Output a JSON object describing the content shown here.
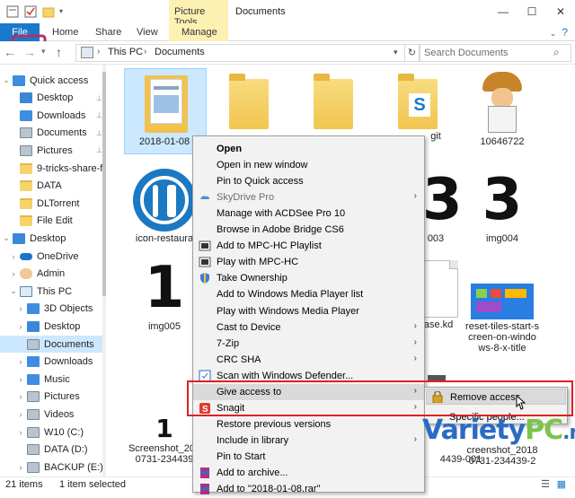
{
  "window": {
    "context_tab_group": "Picture Tools",
    "title": "Documents"
  },
  "ribbon": {
    "tabs": [
      "File",
      "Home",
      "Share",
      "View",
      "Manage"
    ],
    "help": "?"
  },
  "address": {
    "segments": [
      "This PC",
      "Documents"
    ],
    "search_placeholder": "Search Documents"
  },
  "navpane": {
    "items": [
      {
        "label": "Quick access",
        "icon": "star-icon",
        "level": 0
      },
      {
        "label": "Desktop",
        "icon": "desktop-icon",
        "level": 1,
        "pinned": true
      },
      {
        "label": "Downloads",
        "icon": "downloads-icon",
        "level": 1,
        "pinned": true
      },
      {
        "label": "Documents",
        "icon": "documents-icon",
        "level": 1,
        "pinned": true
      },
      {
        "label": "Pictures",
        "icon": "pictures-icon",
        "level": 1,
        "pinned": true
      },
      {
        "label": "9-tricks-share-fil",
        "icon": "folder-icon",
        "level": 1
      },
      {
        "label": "DATA",
        "icon": "folder-icon",
        "level": 1
      },
      {
        "label": "DLTorrent",
        "icon": "folder-icon",
        "level": 1
      },
      {
        "label": "File Edit",
        "icon": "folder-icon",
        "level": 1
      },
      {
        "label": "Desktop",
        "icon": "desktop-icon",
        "level": 0
      },
      {
        "label": "OneDrive",
        "icon": "onedrive-icon",
        "level": 1
      },
      {
        "label": "Admin",
        "icon": "user-icon",
        "level": 1
      },
      {
        "label": "This PC",
        "icon": "pc-icon",
        "level": 1
      },
      {
        "label": "3D Objects",
        "icon": "3d-objects-icon",
        "level": 2
      },
      {
        "label": "Desktop",
        "icon": "desktop-icon",
        "level": 2
      },
      {
        "label": "Documents",
        "icon": "documents-icon",
        "level": 2,
        "selected": true
      },
      {
        "label": "Downloads",
        "icon": "downloads-icon",
        "level": 2
      },
      {
        "label": "Music",
        "icon": "music-icon",
        "level": 2
      },
      {
        "label": "Pictures",
        "icon": "pictures-icon",
        "level": 2
      },
      {
        "label": "Videos",
        "icon": "videos-icon",
        "level": 2
      },
      {
        "label": "W10 (C:)",
        "icon": "drive-icon",
        "level": 2
      },
      {
        "label": "DATA (D:)",
        "icon": "drive-icon",
        "level": 2
      },
      {
        "label": "BACKUP (E:)",
        "icon": "drive-icon",
        "level": 2
      }
    ]
  },
  "files": {
    "items": [
      {
        "label": "2018-01-08",
        "kind": "document-folder"
      },
      {
        "label": "",
        "kind": "folder"
      },
      {
        "label": "",
        "kind": "folder"
      },
      {
        "label": "git",
        "kind": "folder-app"
      },
      {
        "label": "10646722",
        "kind": "image"
      },
      {
        "label": "icon-restaura",
        "kind": "image"
      },
      {
        "label": "003",
        "kind": "image"
      },
      {
        "label": "img004",
        "kind": "image"
      },
      {
        "label": "img005",
        "kind": "image"
      },
      {
        "label": "base.kd",
        "kind": "file"
      },
      {
        "label": "reset-tiles-start-screen-on-windows-8-x-title",
        "kind": "image"
      },
      {
        "label": "Screenshot_20180731-234439",
        "kind": "image"
      },
      {
        "label": "4439-001",
        "kind": "image"
      },
      {
        "label": "Screenshot_2018 0731-234439-2",
        "kind": "image"
      }
    ],
    "reset_label_lines": [
      "reset-tiles-start-s",
      "creen-on-windo",
      "ws-8-x-title"
    ],
    "shot1_lines": [
      "Screenshot_201",
      "0731-234439"
    ],
    "shot2_lines": [
      "creenshot_2018",
      "0731-234439-2"
    ]
  },
  "status": {
    "count": "21 items",
    "selected": "1 item selected"
  },
  "context_menu": {
    "items": [
      {
        "label": "Open",
        "bold": true
      },
      {
        "label": "Open in new window"
      },
      {
        "label": "Pin to Quick access"
      },
      {
        "label": "SkyDrive Pro",
        "disabled": true,
        "submenu": true,
        "icon": "skydrive-icon"
      },
      {
        "label": "Manage with ACDSee Pro 10"
      },
      {
        "label": "Browse in Adobe Bridge CS6"
      },
      {
        "label": "Add to MPC-HC Playlist",
        "icon": "mpc-icon"
      },
      {
        "label": "Play with MPC-HC",
        "icon": "mpc-icon"
      },
      {
        "label": "Take Ownership",
        "icon": "shield-icon"
      },
      {
        "label": "Add to Windows Media Player list"
      },
      {
        "label": "Play with Windows Media Player"
      },
      {
        "label": "Cast to Device",
        "submenu": true
      },
      {
        "label": "7-Zip",
        "submenu": true
      },
      {
        "label": "CRC SHA",
        "submenu": true
      },
      {
        "label": "Scan with Windows Defender...",
        "icon": "defender-icon"
      },
      {
        "label": "Give access to",
        "submenu": true,
        "highlighted": true
      },
      {
        "label": "Snagit",
        "submenu": true,
        "icon": "snagit-icon"
      },
      {
        "label": "Restore previous versions"
      },
      {
        "label": "Include in library",
        "submenu": true
      },
      {
        "label": "Pin to Start"
      },
      {
        "label": "Add to archive...",
        "icon": "archive-icon"
      },
      {
        "label": "Add to \"2018-01-08.rar\"",
        "icon": "archive-icon"
      }
    ],
    "submenu": [
      {
        "label": "Remove access",
        "icon": "lock-icon",
        "highlighted": true
      },
      {
        "label": "Specific people..."
      }
    ]
  },
  "watermark": {
    "main": "Variety",
    "accent": "PC",
    "tld": ".net"
  },
  "colors": {
    "accent": "#1979ca",
    "selection": "#cce8ff",
    "context_tab": "#fdf0b3",
    "annotation_red": "#e02020"
  }
}
